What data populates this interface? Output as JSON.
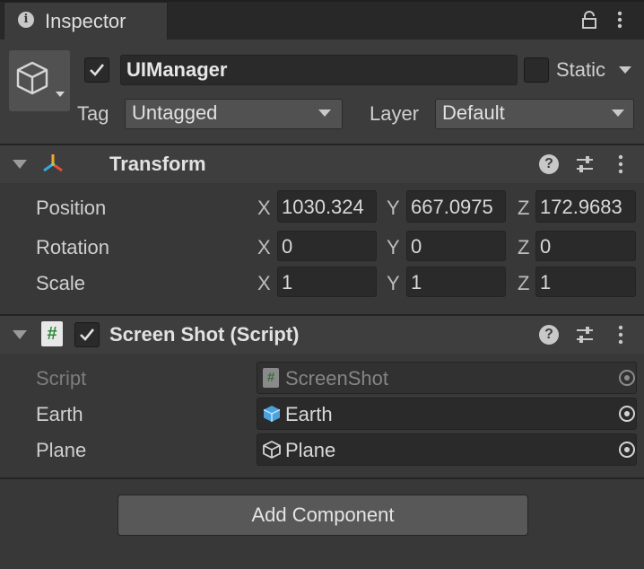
{
  "tab": {
    "title": "Inspector",
    "icon": "info-icon"
  },
  "header": {
    "name": "UIManager",
    "active": true,
    "static_label": "Static",
    "static": false,
    "tag_label": "Tag",
    "tag_value": "Untagged",
    "layer_label": "Layer",
    "layer_value": "Default"
  },
  "transform": {
    "title": "Transform",
    "rows": [
      {
        "label": "Position",
        "x": "1030.324",
        "y": "667.0975",
        "z": "172.9683"
      },
      {
        "label": "Rotation",
        "x": "0",
        "y": "0",
        "z": "0"
      },
      {
        "label": "Scale",
        "x": "1",
        "y": "1",
        "z": "1"
      }
    ],
    "axes": {
      "x": "X",
      "y": "Y",
      "z": "Z"
    }
  },
  "script_component": {
    "title": "Screen Shot (Script)",
    "enabled": true,
    "fields": [
      {
        "label": "Script",
        "value": "ScreenShot",
        "icon": "script-icon",
        "disabled": true
      },
      {
        "label": "Earth",
        "value": "Earth",
        "icon": "prefab-icon"
      },
      {
        "label": "Plane",
        "value": "Plane",
        "icon": "gameobject-icon"
      }
    ]
  },
  "add_component_label": "Add Component",
  "colors": {
    "bg": "#383838",
    "field": "#2a2a2a",
    "header": "#3c3c3c"
  }
}
